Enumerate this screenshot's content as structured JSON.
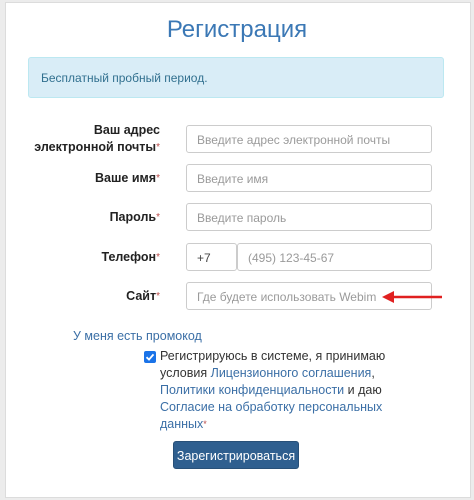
{
  "form": {
    "title": "Регистрация",
    "alert": "Бесплатный пробный период.",
    "email": {
      "label_line1": "Ваш адрес",
      "label_line2": "электронной почты",
      "placeholder": "Введите адрес электронной почты"
    },
    "name": {
      "label": "Ваше имя",
      "placeholder": "Введите имя"
    },
    "password": {
      "label": "Пароль",
      "placeholder": "Введите пароль"
    },
    "phone": {
      "label": "Телефон",
      "code": "+7",
      "placeholder": "(495) 123-45-67"
    },
    "site": {
      "label": "Сайт",
      "placeholder": "Где будете использовать Webim"
    },
    "required_mark": "*",
    "promo_link": "У меня есть промокод",
    "agreement": {
      "checked": true,
      "text1": "Регистрируюсь в системе, я принимаю условия ",
      "link1": "Лицензионного соглашения",
      "sep": ", ",
      "link2": "Политики конфиденциальности",
      "and": " и даю ",
      "link3": "Согласие на обработку персональных данных"
    },
    "submit": "Зарегистрироваться"
  },
  "colors": {
    "accent": "#3b78b5",
    "button": "#2f5f8f",
    "alert_bg": "#d9edf7",
    "arrow": "#e02020"
  }
}
